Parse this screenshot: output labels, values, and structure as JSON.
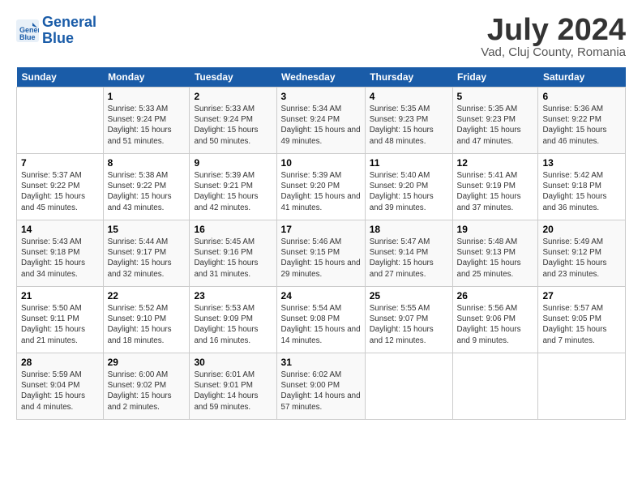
{
  "header": {
    "logo_line1": "General",
    "logo_line2": "Blue",
    "title": "July 2024",
    "subtitle": "Vad, Cluj County, Romania"
  },
  "columns": [
    "Sunday",
    "Monday",
    "Tuesday",
    "Wednesday",
    "Thursday",
    "Friday",
    "Saturday"
  ],
  "weeks": [
    [
      {
        "day": "",
        "info": ""
      },
      {
        "day": "1",
        "info": "Sunrise: 5:33 AM\nSunset: 9:24 PM\nDaylight: 15 hours\nand 51 minutes."
      },
      {
        "day": "2",
        "info": "Sunrise: 5:33 AM\nSunset: 9:24 PM\nDaylight: 15 hours\nand 50 minutes."
      },
      {
        "day": "3",
        "info": "Sunrise: 5:34 AM\nSunset: 9:24 PM\nDaylight: 15 hours\nand 49 minutes."
      },
      {
        "day": "4",
        "info": "Sunrise: 5:35 AM\nSunset: 9:23 PM\nDaylight: 15 hours\nand 48 minutes."
      },
      {
        "day": "5",
        "info": "Sunrise: 5:35 AM\nSunset: 9:23 PM\nDaylight: 15 hours\nand 47 minutes."
      },
      {
        "day": "6",
        "info": "Sunrise: 5:36 AM\nSunset: 9:22 PM\nDaylight: 15 hours\nand 46 minutes."
      }
    ],
    [
      {
        "day": "7",
        "info": "Sunrise: 5:37 AM\nSunset: 9:22 PM\nDaylight: 15 hours\nand 45 minutes."
      },
      {
        "day": "8",
        "info": "Sunrise: 5:38 AM\nSunset: 9:22 PM\nDaylight: 15 hours\nand 43 minutes."
      },
      {
        "day": "9",
        "info": "Sunrise: 5:39 AM\nSunset: 9:21 PM\nDaylight: 15 hours\nand 42 minutes."
      },
      {
        "day": "10",
        "info": "Sunrise: 5:39 AM\nSunset: 9:20 PM\nDaylight: 15 hours\nand 41 minutes."
      },
      {
        "day": "11",
        "info": "Sunrise: 5:40 AM\nSunset: 9:20 PM\nDaylight: 15 hours\nand 39 minutes."
      },
      {
        "day": "12",
        "info": "Sunrise: 5:41 AM\nSunset: 9:19 PM\nDaylight: 15 hours\nand 37 minutes."
      },
      {
        "day": "13",
        "info": "Sunrise: 5:42 AM\nSunset: 9:18 PM\nDaylight: 15 hours\nand 36 minutes."
      }
    ],
    [
      {
        "day": "14",
        "info": "Sunrise: 5:43 AM\nSunset: 9:18 PM\nDaylight: 15 hours\nand 34 minutes."
      },
      {
        "day": "15",
        "info": "Sunrise: 5:44 AM\nSunset: 9:17 PM\nDaylight: 15 hours\nand 32 minutes."
      },
      {
        "day": "16",
        "info": "Sunrise: 5:45 AM\nSunset: 9:16 PM\nDaylight: 15 hours\nand 31 minutes."
      },
      {
        "day": "17",
        "info": "Sunrise: 5:46 AM\nSunset: 9:15 PM\nDaylight: 15 hours\nand 29 minutes."
      },
      {
        "day": "18",
        "info": "Sunrise: 5:47 AM\nSunset: 9:14 PM\nDaylight: 15 hours\nand 27 minutes."
      },
      {
        "day": "19",
        "info": "Sunrise: 5:48 AM\nSunset: 9:13 PM\nDaylight: 15 hours\nand 25 minutes."
      },
      {
        "day": "20",
        "info": "Sunrise: 5:49 AM\nSunset: 9:12 PM\nDaylight: 15 hours\nand 23 minutes."
      }
    ],
    [
      {
        "day": "21",
        "info": "Sunrise: 5:50 AM\nSunset: 9:11 PM\nDaylight: 15 hours\nand 21 minutes."
      },
      {
        "day": "22",
        "info": "Sunrise: 5:52 AM\nSunset: 9:10 PM\nDaylight: 15 hours\nand 18 minutes."
      },
      {
        "day": "23",
        "info": "Sunrise: 5:53 AM\nSunset: 9:09 PM\nDaylight: 15 hours\nand 16 minutes."
      },
      {
        "day": "24",
        "info": "Sunrise: 5:54 AM\nSunset: 9:08 PM\nDaylight: 15 hours\nand 14 minutes."
      },
      {
        "day": "25",
        "info": "Sunrise: 5:55 AM\nSunset: 9:07 PM\nDaylight: 15 hours\nand 12 minutes."
      },
      {
        "day": "26",
        "info": "Sunrise: 5:56 AM\nSunset: 9:06 PM\nDaylight: 15 hours\nand 9 minutes."
      },
      {
        "day": "27",
        "info": "Sunrise: 5:57 AM\nSunset: 9:05 PM\nDaylight: 15 hours\nand 7 minutes."
      }
    ],
    [
      {
        "day": "28",
        "info": "Sunrise: 5:59 AM\nSunset: 9:04 PM\nDaylight: 15 hours\nand 4 minutes."
      },
      {
        "day": "29",
        "info": "Sunrise: 6:00 AM\nSunset: 9:02 PM\nDaylight: 15 hours\nand 2 minutes."
      },
      {
        "day": "30",
        "info": "Sunrise: 6:01 AM\nSunset: 9:01 PM\nDaylight: 14 hours\nand 59 minutes."
      },
      {
        "day": "31",
        "info": "Sunrise: 6:02 AM\nSunset: 9:00 PM\nDaylight: 14 hours\nand 57 minutes."
      },
      {
        "day": "",
        "info": ""
      },
      {
        "day": "",
        "info": ""
      },
      {
        "day": "",
        "info": ""
      }
    ]
  ]
}
